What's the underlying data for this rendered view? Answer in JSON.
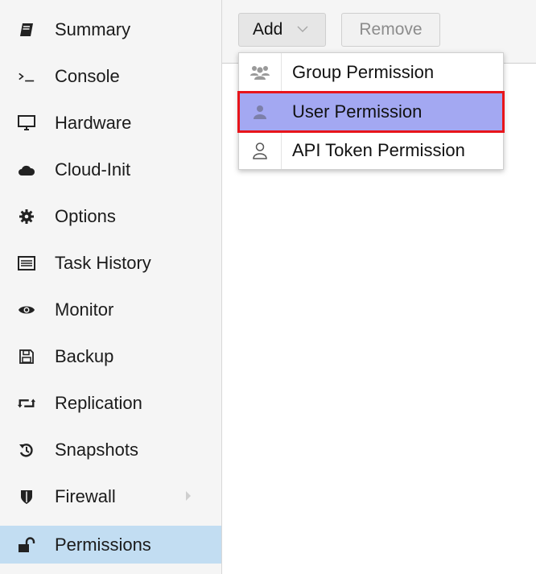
{
  "sidebar": {
    "items": [
      {
        "label": "Summary",
        "icon": "book-icon"
      },
      {
        "label": "Console",
        "icon": "terminal-icon"
      },
      {
        "label": "Hardware",
        "icon": "monitor-icon"
      },
      {
        "label": "Cloud-Init",
        "icon": "cloud-icon"
      },
      {
        "label": "Options",
        "icon": "gear-icon"
      },
      {
        "label": "Task History",
        "icon": "list-icon"
      },
      {
        "label": "Monitor",
        "icon": "eye-icon"
      },
      {
        "label": "Backup",
        "icon": "floppy-icon"
      },
      {
        "label": "Replication",
        "icon": "retweet-icon"
      },
      {
        "label": "Snapshots",
        "icon": "history-icon"
      },
      {
        "label": "Firewall",
        "icon": "shield-icon"
      },
      {
        "label": "Permissions",
        "icon": "unlock-icon"
      }
    ],
    "active": "Permissions",
    "active_color": "#c2ddf2"
  },
  "toolbar": {
    "add_label": "Add",
    "remove_label": "Remove"
  },
  "menu": {
    "items": [
      {
        "label": "Group Permission",
        "icon": "users-icon"
      },
      {
        "label": "User Permission",
        "icon": "user-icon"
      },
      {
        "label": "API Token Permission",
        "icon": "user-outline-icon"
      }
    ],
    "highlighted": "User Permission",
    "highlight_color": "#a3a8f2",
    "highlight_border_color": "#e8151b"
  }
}
